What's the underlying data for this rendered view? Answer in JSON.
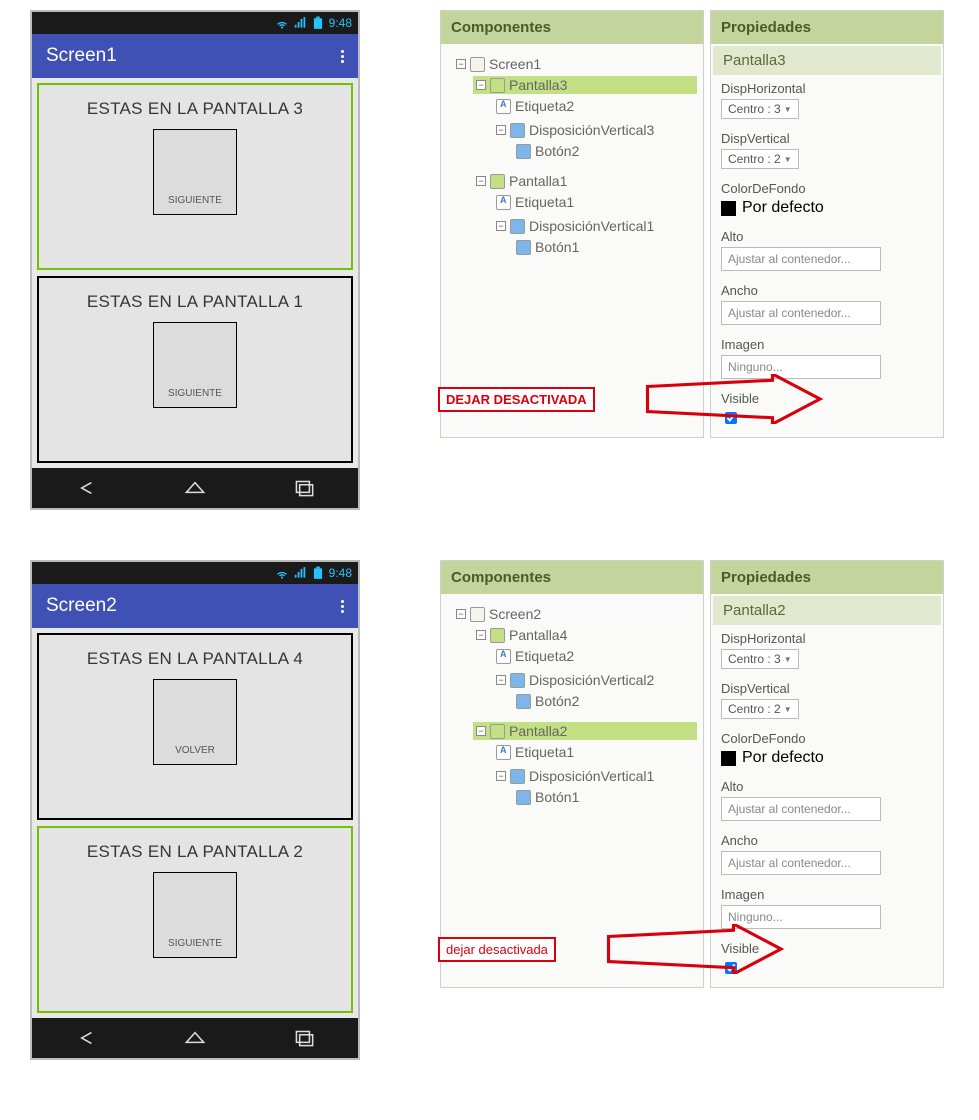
{
  "status": {
    "time": "9:48",
    "wifi": "wifi-icon",
    "signal": "signal-icon",
    "bat": "battery-icon"
  },
  "phones": {
    "p1": {
      "title": "Screen1",
      "card1": {
        "label": "ESTAS EN LA PANTALLA 3",
        "btn": "SIGUIENTE",
        "green": true
      },
      "card2": {
        "label": "ESTAS EN LA PANTALLA 1",
        "btn": "SIGUIENTE",
        "green": false
      }
    },
    "p2": {
      "title": "Screen2",
      "card1": {
        "label": "ESTAS EN LA PANTALLA 4",
        "btn": "VOLVER",
        "green": false
      },
      "card2": {
        "label": "ESTAS EN LA PANTALLA 2",
        "btn": "SIGUIENTE",
        "green": true
      }
    }
  },
  "panels": {
    "comp_head": "Componentes",
    "prop_head": "Propiedades",
    "set1": {
      "selected": "Pantalla3",
      "tree": {
        "root": "Screen1",
        "a": "Pantalla3",
        "a1": "Etiqueta2",
        "a2": "DisposiciónVertical3",
        "a3": "Botón2",
        "b": "Pantalla1",
        "b1": "Etiqueta1",
        "b2": "DisposiciónVertical1",
        "b3": "Botón1"
      },
      "annot": "DEJAR DESACTIVADA"
    },
    "set2": {
      "selected": "Pantalla2",
      "tree": {
        "root": "Screen2",
        "a": "Pantalla4",
        "a1": "Etiqueta2",
        "a2": "DisposiciónVertical2",
        "a3": "Botón2",
        "b": "Pantalla2",
        "b1": "Etiqueta1",
        "b2": "DisposiciónVertical1",
        "b3": "Botón1"
      },
      "annot": "dejar desactivada"
    },
    "props": {
      "dh_label": "DispHorizontal",
      "dh_val": "Centro : 3",
      "dv_label": "DispVertical",
      "dv_val": "Centro : 2",
      "bg_label": "ColorDeFondo",
      "bg_val": "Por defecto",
      "h_label": "Alto",
      "h_val": "Ajustar al contenedor...",
      "w_label": "Ancho",
      "w_val": "Ajustar al contenedor...",
      "img_label": "Imagen",
      "img_val": "Ninguno...",
      "vis_label": "Visible"
    }
  }
}
